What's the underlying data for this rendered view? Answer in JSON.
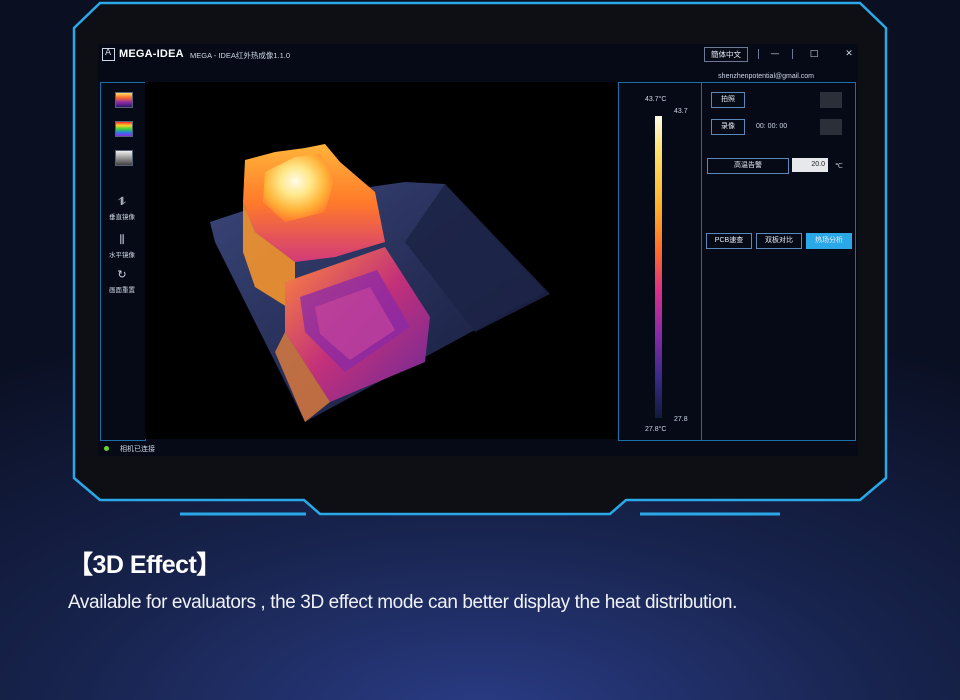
{
  "app": {
    "logo_mark": "A",
    "logo_text": "MEGA-IDEA",
    "title": "MEGA - IDEA红外热成像1.1.0",
    "language_button": "簡体中文",
    "window_controls": {
      "minimize": "—",
      "maximize": "□",
      "close": "✕"
    },
    "account_email": "shenzhenpotential@gmail.com"
  },
  "left_toolbar": {
    "palette_icons": [
      "iron-palette-icon",
      "rainbow-palette-icon",
      "grayscale-palette-icon"
    ],
    "tools": [
      {
        "icon": "vertical-mirror-icon",
        "symbol": "⥮",
        "label": "垂直镜像"
      },
      {
        "icon": "horizontal-mirror-icon",
        "symbol": "⫼",
        "label": "水平镜像"
      },
      {
        "icon": "reset-view-icon",
        "symbol": "↻",
        "label": "画面重置"
      }
    ]
  },
  "temperature_scale": {
    "max_header": "43.7°C",
    "max_value": "43.7",
    "min_value": "27.8",
    "min_footer": "27.8°C"
  },
  "right_panel": {
    "capture_button": "拍照",
    "record_button": "录像",
    "record_timer": "00: 00: 00",
    "high_temp_alarm_button": "高温告警",
    "alarm_threshold": "20.0",
    "alarm_unit": "℃",
    "mode_buttons": [
      "PCB速查",
      "双板对比",
      "热场分析"
    ],
    "active_mode": "热场分析",
    "accent_color": "#2aa8e8"
  },
  "status": {
    "text": "相机已连接",
    "color": "#6ad22a"
  },
  "caption": {
    "title": "【3D Effect】",
    "description": "Available for evaluators , the 3D effect mode can better display the heat distribution."
  }
}
